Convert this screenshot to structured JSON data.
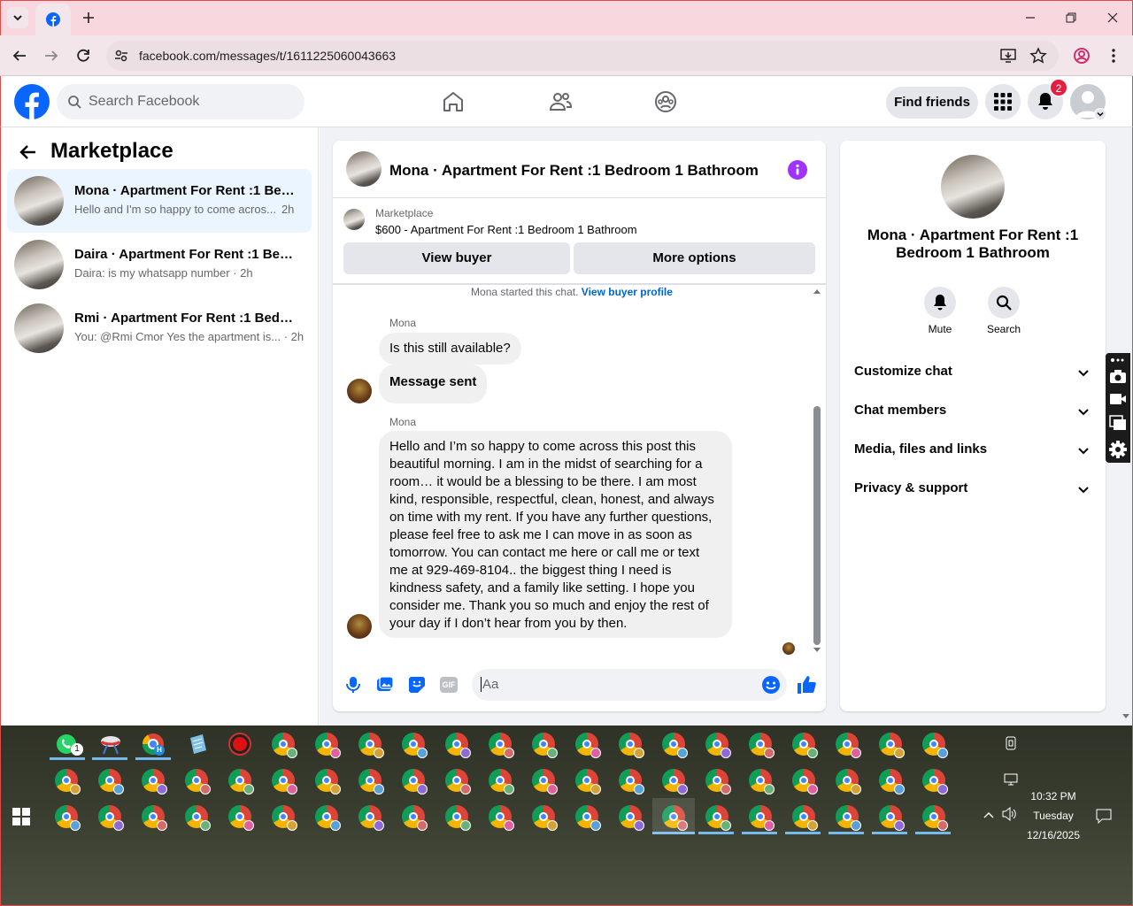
{
  "browser": {
    "url": "facebook.com/messages/t/1611225060043663"
  },
  "fb": {
    "search_placeholder": "Search Facebook",
    "find_friends": "Find friends",
    "notification_count": "2"
  },
  "sidebar": {
    "title": "Marketplace",
    "conversations": [
      {
        "title": "Mona · Apartment For Rent :1 Bedroom 1 Bathroom",
        "preview": "Hello and I'm so happy to come acros...",
        "time": "2h",
        "selected": true
      },
      {
        "title": "Daira · Apartment For Rent :1 Bedroom 1 Bathroom",
        "preview": "Daira: is my whatsapp number",
        "time": "2h",
        "selected": false
      },
      {
        "title": "Rmi · Apartment For Rent :1 Bedroom 1 Bathroom",
        "preview": "You: @Rmi Cmor Yes the apartment is...",
        "time": "2h",
        "selected": false
      }
    ]
  },
  "chat": {
    "header_title": "Mona · Apartment For Rent :1 Bedroom 1 Bathroom",
    "listing_label": "Marketplace",
    "listing_text": "$600 - Apartment For Rent :1 Bedroom 1 Bathroom",
    "view_buyer": "View buyer",
    "more_options": "More options",
    "started_text": "Mona started this chat.",
    "view_buyer_profile": "View buyer profile",
    "sender1": "Mona",
    "msg1": "Is this still available?",
    "msg2": "Message sent",
    "sender2": "Mona",
    "msg3_lines": [
      "Hello and I’m so happy to come across this post this",
      "beautiful morning. I am in the midst of searching for a",
      "room… it would be a blessing to be there. I am most",
      "kind, responsible, respectful, clean, honest, and always",
      "on time with my rent. If you have any further questions,",
      "please feel free to ask me I can move in as soon as",
      "tomorrow. You can contact me here or call me or text",
      "me at 929-469-8104.. the biggest thing I need is",
      "kindness safety, and a family like setting. I hope you",
      "consider me. Thank you so much and enjoy the rest of",
      "your day if I don’t hear from you by then."
    ],
    "composer_placeholder": "Aa",
    "gif_label": "GIF"
  },
  "info": {
    "name": "Mona · Apartment For Rent :1 Bedroom 1 Bathroom",
    "mute": "Mute",
    "search": "Search",
    "sections": [
      "Customize chat",
      "Chat members",
      "Media, files and links",
      "Privacy & support"
    ]
  },
  "taskbar": {
    "time": "10:32 PM",
    "day": "Tuesday",
    "date": "12/16/2025",
    "whatsapp_badge": "1",
    "h_badge": "H"
  },
  "colors": {
    "fb_blue": "#0866ff",
    "accent_purple": "#a033ff",
    "selected_row": "#ebf5ff",
    "notif_red": "#e41e3f"
  }
}
